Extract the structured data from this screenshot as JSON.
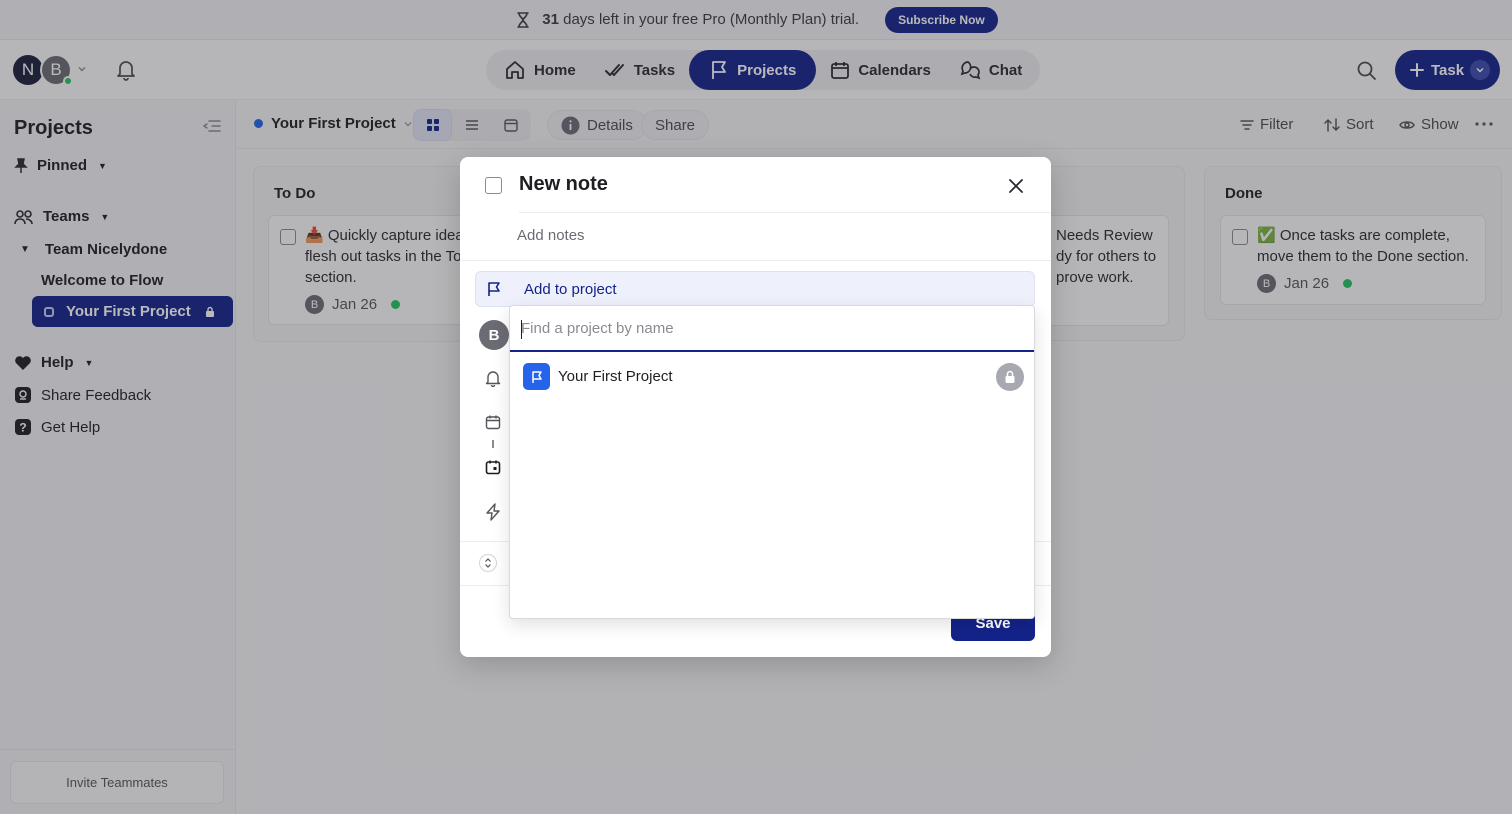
{
  "banner": {
    "days": "31",
    "text": "days left in your free Pro (Monthly Plan) trial.",
    "subscribe_label": "Subscribe Now"
  },
  "header": {
    "user_initials": [
      "N",
      "B"
    ],
    "nav": [
      {
        "label": "Home",
        "icon": "home-icon"
      },
      {
        "label": "Tasks",
        "icon": "double-check-icon"
      },
      {
        "label": "Projects",
        "icon": "flag-icon",
        "active": true
      },
      {
        "label": "Calendars",
        "icon": "calendar-icon"
      },
      {
        "label": "Chat",
        "icon": "chat-icon"
      }
    ],
    "task_button_label": "Task"
  },
  "sidebar": {
    "title": "Projects",
    "pinned_label": "Pinned",
    "teams_label": "Teams",
    "team_name": "Team Nicelydone",
    "welcome_label": "Welcome to Flow",
    "active_project": "Your First Project",
    "help_label": "Help",
    "share_feedback_label": "Share Feedback",
    "get_help_label": "Get Help",
    "invite_label": "Invite Teammates"
  },
  "toolbar": {
    "project_name": "Your First Project",
    "details_label": "Details",
    "share_label": "Share",
    "filter_label": "Filter",
    "sort_label": "Sort",
    "show_label": "Show"
  },
  "board": {
    "todo": {
      "title": "To Do",
      "card_lines": [
        "📥 Quickly capture idea",
        "flesh out tasks in the To",
        "section."
      ],
      "avatar": "B",
      "date": "Jan 26"
    },
    "review": {
      "card_lines": [
        "Needs Review",
        "dy for others to",
        "prove work."
      ]
    },
    "done": {
      "title": "Done",
      "card_lines": [
        "✅ Once tasks are complete,",
        "move them to the Done section."
      ],
      "avatar": "B",
      "date": "Jan 26"
    }
  },
  "modal": {
    "title": "New note",
    "notes_placeholder": "Add notes",
    "add_to_project_label": "Add to project",
    "assignee_initial": "B",
    "save_label": "Save"
  },
  "dropdown": {
    "search_placeholder": "Find a project by name",
    "items": [
      {
        "name": "Your First Project",
        "private": true
      }
    ]
  },
  "colors": {
    "brand": "#14238a",
    "project_blue": "#2563eb",
    "online_green": "#22c55e"
  }
}
